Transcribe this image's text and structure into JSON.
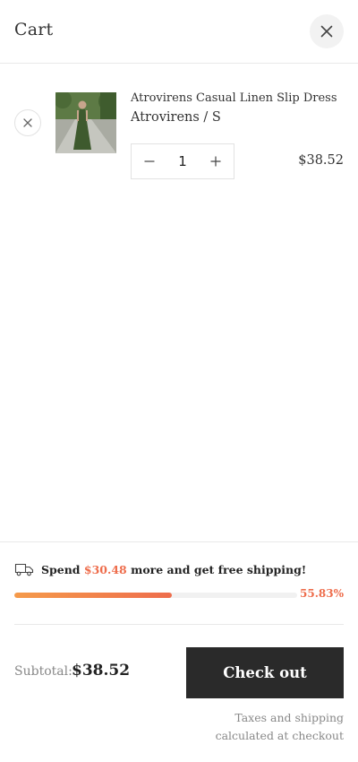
{
  "header": {
    "title": "Cart",
    "close_icon": "close-icon"
  },
  "cart_item": {
    "name": "Atrovirens Casual Linen Slip Dress",
    "variant": "Atrovirens / S",
    "quantity": "1",
    "price": "$38.52",
    "remove_icon": "close-icon",
    "image": "product-thumbnail-green-dress"
  },
  "shipping": {
    "prefix": "Spend ",
    "amount": "$30.48",
    "suffix": " more and get free shipping!",
    "progress_percent": 55.83,
    "progress_label": "55.83%",
    "icon": "truck-icon"
  },
  "summary": {
    "subtotal_label": "Subtotal:",
    "subtotal_value": "$38.52",
    "checkout_label": "Check out",
    "tax_note": "Taxes and shipping calculated at checkout"
  },
  "colors": {
    "accent": "#ee6d4c",
    "checkout_bg": "#2a2a2a"
  }
}
